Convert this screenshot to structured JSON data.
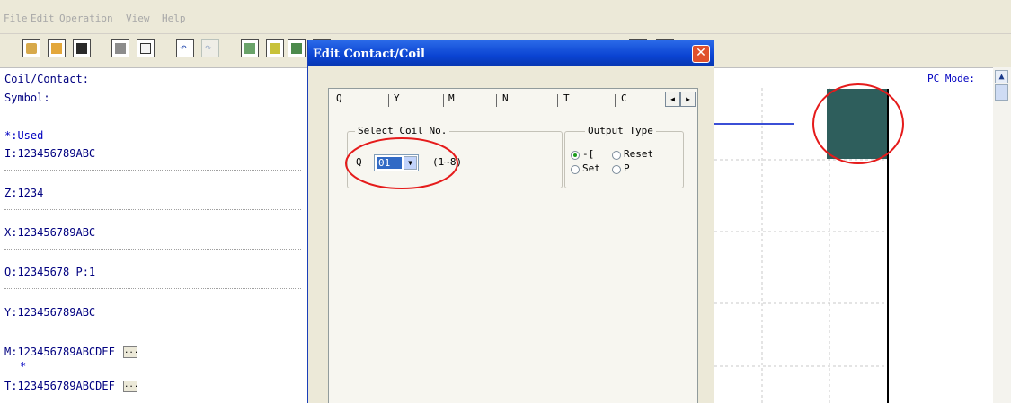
{
  "menu": [
    "File",
    "Edit",
    "Operation",
    "View",
    "Help"
  ],
  "toolbar_icons": [
    "new-file-icon",
    "open-folder-icon",
    "save-icon",
    "print-setup-icon",
    "print-preview-icon",
    "undo-icon",
    "redo-icon",
    "monitor-icon",
    "ladder-icon",
    "tool-icon"
  ],
  "left_panel": {
    "header1": "Coil/Contact:",
    "header2": "Symbol:",
    "used": "*:Used",
    "rows": [
      {
        "text": "I:123456789ABC"
      },
      {
        "text": "Z:1234"
      },
      {
        "text": "X:123456789ABC"
      },
      {
        "text": "Q:12345678 P:1"
      },
      {
        "text": "Y:123456789ABC"
      },
      {
        "text": "M:123456789ABCDEF"
      },
      {
        "text": "T:123456789ABCDEF"
      }
    ],
    "marker": "*"
  },
  "right_panel": {
    "mode_label": "PC Mode:"
  },
  "dialog": {
    "title": "Edit Contact/Coil",
    "close_symbol": "✕",
    "tabs": [
      "Q",
      "Y",
      "M",
      "N",
      "T",
      "C"
    ],
    "group_coil": {
      "label": "Select Coil No.",
      "prefix": "Q",
      "value": "01",
      "range": "(1~8)"
    },
    "group_output": {
      "label": "Output Type",
      "options": [
        "-[",
        "Reset",
        "Set",
        "P"
      ],
      "selected": "-["
    }
  },
  "colors": {
    "dialog_title": "#0a43d2",
    "highlight_circle": "#e51b1b",
    "coil_block": "#2e5e5c",
    "ladder_line": "#3b4fd6",
    "left_text": "#000080",
    "used_text": "#0000c0"
  }
}
